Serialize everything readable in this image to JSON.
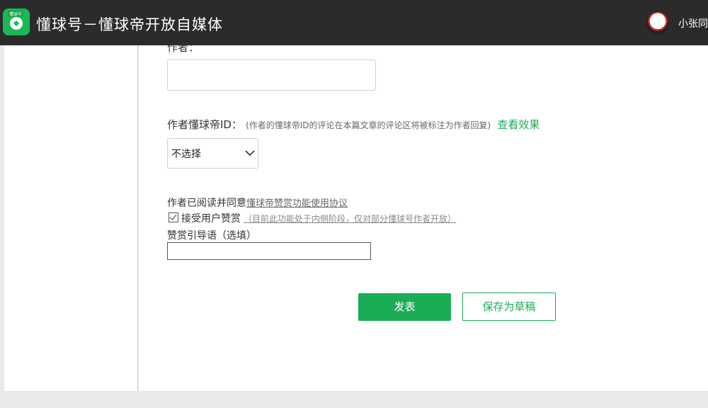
{
  "header": {
    "logo_tag": "懂球号",
    "title": "懂球号－懂球帝开放自媒体",
    "username": "小张同学"
  },
  "form": {
    "author_label": "作者：",
    "author_value": "",
    "author_id_label": "作者懂球帝ID：",
    "author_id_hint": "(作者的懂球帝ID的评论在本篇文章的评论区将被标注为作者回复)",
    "view_effect": "查看效果",
    "author_id_select": "不选择",
    "agree_text": "作者已阅读并同意",
    "agree_link": "懂球帝赞赏功能使用协议",
    "reward_checkbox_label": "接受用户赞赏",
    "reward_note": "（目前此功能处于内侧阶段，仅对部分懂球号作者开放）",
    "reward_guide_label": "赞赏引导语（选填）",
    "reward_guide_value": "",
    "reward_checked": true
  },
  "actions": {
    "publish": "发表",
    "save_draft": "保存为草稿"
  },
  "colors": {
    "accent": "#1aad55",
    "topbar": "#2b2b2b"
  }
}
